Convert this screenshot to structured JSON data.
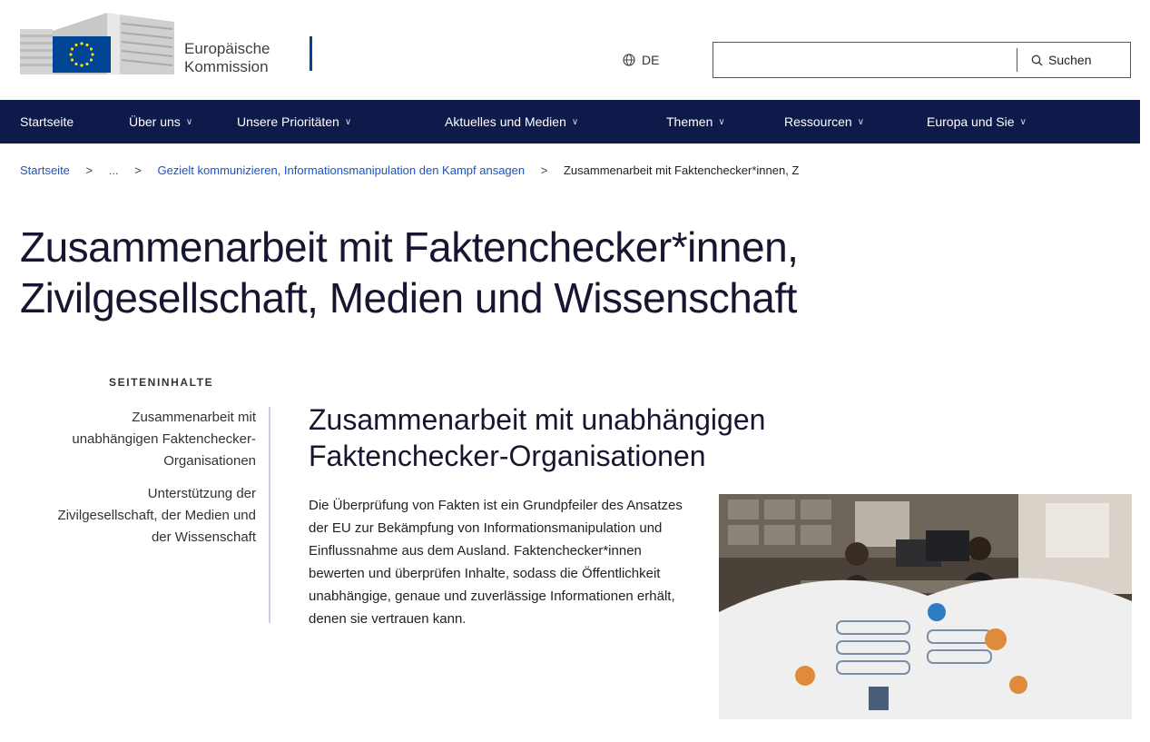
{
  "header": {
    "logo_line1": "Europäische",
    "logo_line2": "Kommission",
    "language": "DE",
    "search_placeholder": "",
    "search_label": "Suchen"
  },
  "nav": {
    "items": [
      {
        "label": "Startseite",
        "has_dropdown": false
      },
      {
        "label": "Über uns",
        "has_dropdown": true
      },
      {
        "label": "Unsere Prioritäten",
        "has_dropdown": true
      },
      {
        "label": "Aktuelles und Medien",
        "has_dropdown": true
      },
      {
        "label": "Themen",
        "has_dropdown": true
      },
      {
        "label": "Ressourcen",
        "has_dropdown": true
      },
      {
        "label": "Europa und Sie",
        "has_dropdown": true
      }
    ]
  },
  "breadcrumb": {
    "home": "Startseite",
    "ellipsis": "...",
    "parent": "Gezielt kommunizieren, Informationsmanipulation den Kampf ansagen",
    "current": "Zusammenarbeit mit Faktenchecker*innen, Z"
  },
  "page": {
    "title_line1": "Zusammenarbeit mit Faktenchecker*innen,",
    "title_line2": "Zivilgesellschaft, Medien und Wissenschaft"
  },
  "toc": {
    "heading": "SEITENINHALTE",
    "items": [
      "Zusammenarbeit mit unabhängigen Faktenchecker-Organisationen",
      "Unterstützung der Zivilgesellschaft, der Medien und der Wissenschaft"
    ]
  },
  "section": {
    "heading_line1": "Zusammenarbeit mit unabhängigen",
    "heading_line2": "Faktenchecker-Organisationen",
    "paragraph": "Die Überprüfung von Fakten ist ein Grundpfeiler des Ansatzes der EU zur Bekämpfung von Informationsmanipulation und Einflussnahme aus dem Ausland. Faktenchecker*innen bewerten und überprüfen Inhalte, sodass die Öffentlichkeit unabhängige, genaue und zuverlässige Informationen erhält, denen sie vertrauen kann."
  },
  "colors": {
    "nav_bg": "#0e1a4a",
    "eu_blue": "#004494",
    "eu_yellow": "#ffd617",
    "link": "#1a54c4"
  }
}
